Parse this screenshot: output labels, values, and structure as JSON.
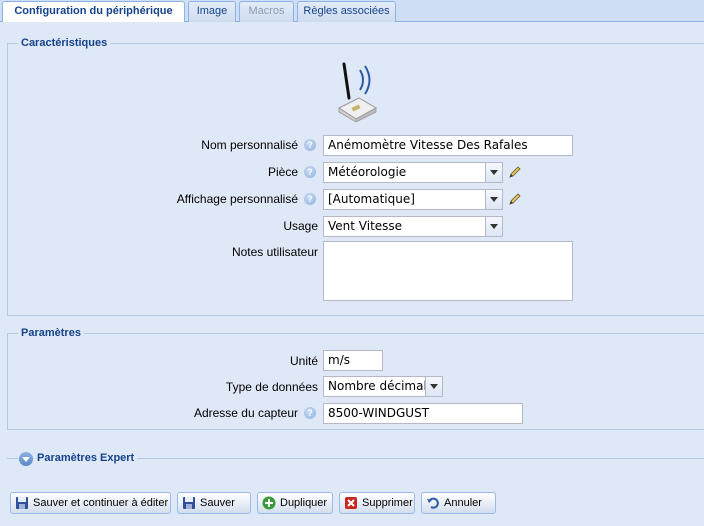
{
  "tabs": [
    {
      "label": "Configuration du périphérique",
      "state": "active"
    },
    {
      "label": "Image",
      "state": "normal"
    },
    {
      "label": "Macros",
      "state": "disabled"
    },
    {
      "label": "Règles associées",
      "state": "normal"
    }
  ],
  "characteristics": {
    "legend": "Caractéristiques",
    "device_icon": "antenna-device-icon",
    "name_label": "Nom personnalisé",
    "name_value": "Anémomètre Vitesse Des Rafales",
    "room_label": "Pièce",
    "room_value": "Météorologie",
    "display_label": "Affichage personnalisé",
    "display_value": "[Automatique]",
    "usage_label": "Usage",
    "usage_value": "Vent Vitesse",
    "notes_label": "Notes utilisateur",
    "notes_value": ""
  },
  "parameters": {
    "legend": "Paramètres",
    "unit_label": "Unité",
    "unit_value": "m/s",
    "datatype_label": "Type de données",
    "datatype_value": "Nombre décimal",
    "address_label": "Adresse du capteur",
    "address_value": "8500-WINDGUST"
  },
  "expert": {
    "label": "Paramètres Expert"
  },
  "buttons": {
    "save_continue": "Sauver et continuer à éditer",
    "save": "Sauver",
    "duplicate": "Dupliquer",
    "delete": "Supprimer",
    "cancel": "Annuler"
  },
  "colors": {
    "accent": "#15428b",
    "background": "#dfe8f6",
    "border": "#b5c8e2"
  }
}
